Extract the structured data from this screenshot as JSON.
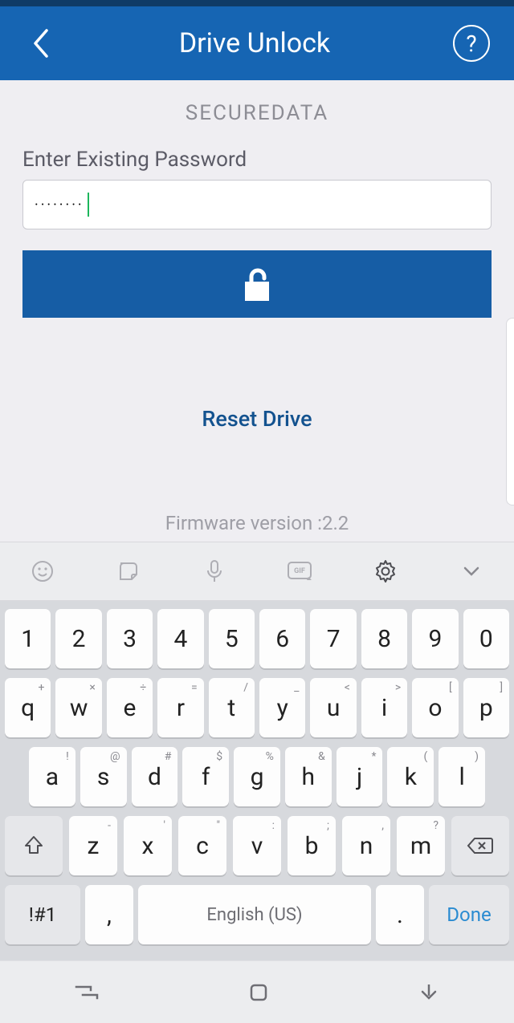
{
  "header": {
    "title": "Drive Unlock"
  },
  "brand": "SECUREDATA",
  "form": {
    "password_label": "Enter Existing Password",
    "password_value": "········",
    "reset_label": "Reset Drive"
  },
  "firmware_text": "Firmware version :2.2",
  "keyboard": {
    "row_numbers": [
      "1",
      "2",
      "3",
      "4",
      "5",
      "6",
      "7",
      "8",
      "9",
      "0"
    ],
    "row_q": [
      {
        "main": "q",
        "alt": "+"
      },
      {
        "main": "w",
        "alt": "×"
      },
      {
        "main": "e",
        "alt": "÷"
      },
      {
        "main": "r",
        "alt": "="
      },
      {
        "main": "t",
        "alt": "/"
      },
      {
        "main": "y",
        "alt": "_"
      },
      {
        "main": "u",
        "alt": "<"
      },
      {
        "main": "i",
        "alt": ">"
      },
      {
        "main": "o",
        "alt": "["
      },
      {
        "main": "p",
        "alt": "]"
      }
    ],
    "row_a": [
      {
        "main": "a",
        "alt": "!"
      },
      {
        "main": "s",
        "alt": "@"
      },
      {
        "main": "d",
        "alt": "#"
      },
      {
        "main": "f",
        "alt": "$"
      },
      {
        "main": "g",
        "alt": "%"
      },
      {
        "main": "h",
        "alt": "&"
      },
      {
        "main": "j",
        "alt": "*"
      },
      {
        "main": "k",
        "alt": "("
      },
      {
        "main": "l",
        "alt": ")"
      }
    ],
    "row_z": [
      {
        "main": "z",
        "alt": "-"
      },
      {
        "main": "x",
        "alt": "'"
      },
      {
        "main": "c",
        "alt": "\""
      },
      {
        "main": "v",
        "alt": ":"
      },
      {
        "main": "b",
        "alt": ";"
      },
      {
        "main": "n",
        "alt": ","
      },
      {
        "main": "m",
        "alt": "?"
      }
    ],
    "sym_label": "!#1",
    "comma_label": ",",
    "space_label": "English (US)",
    "period_label": ".",
    "done_label": "Done"
  }
}
